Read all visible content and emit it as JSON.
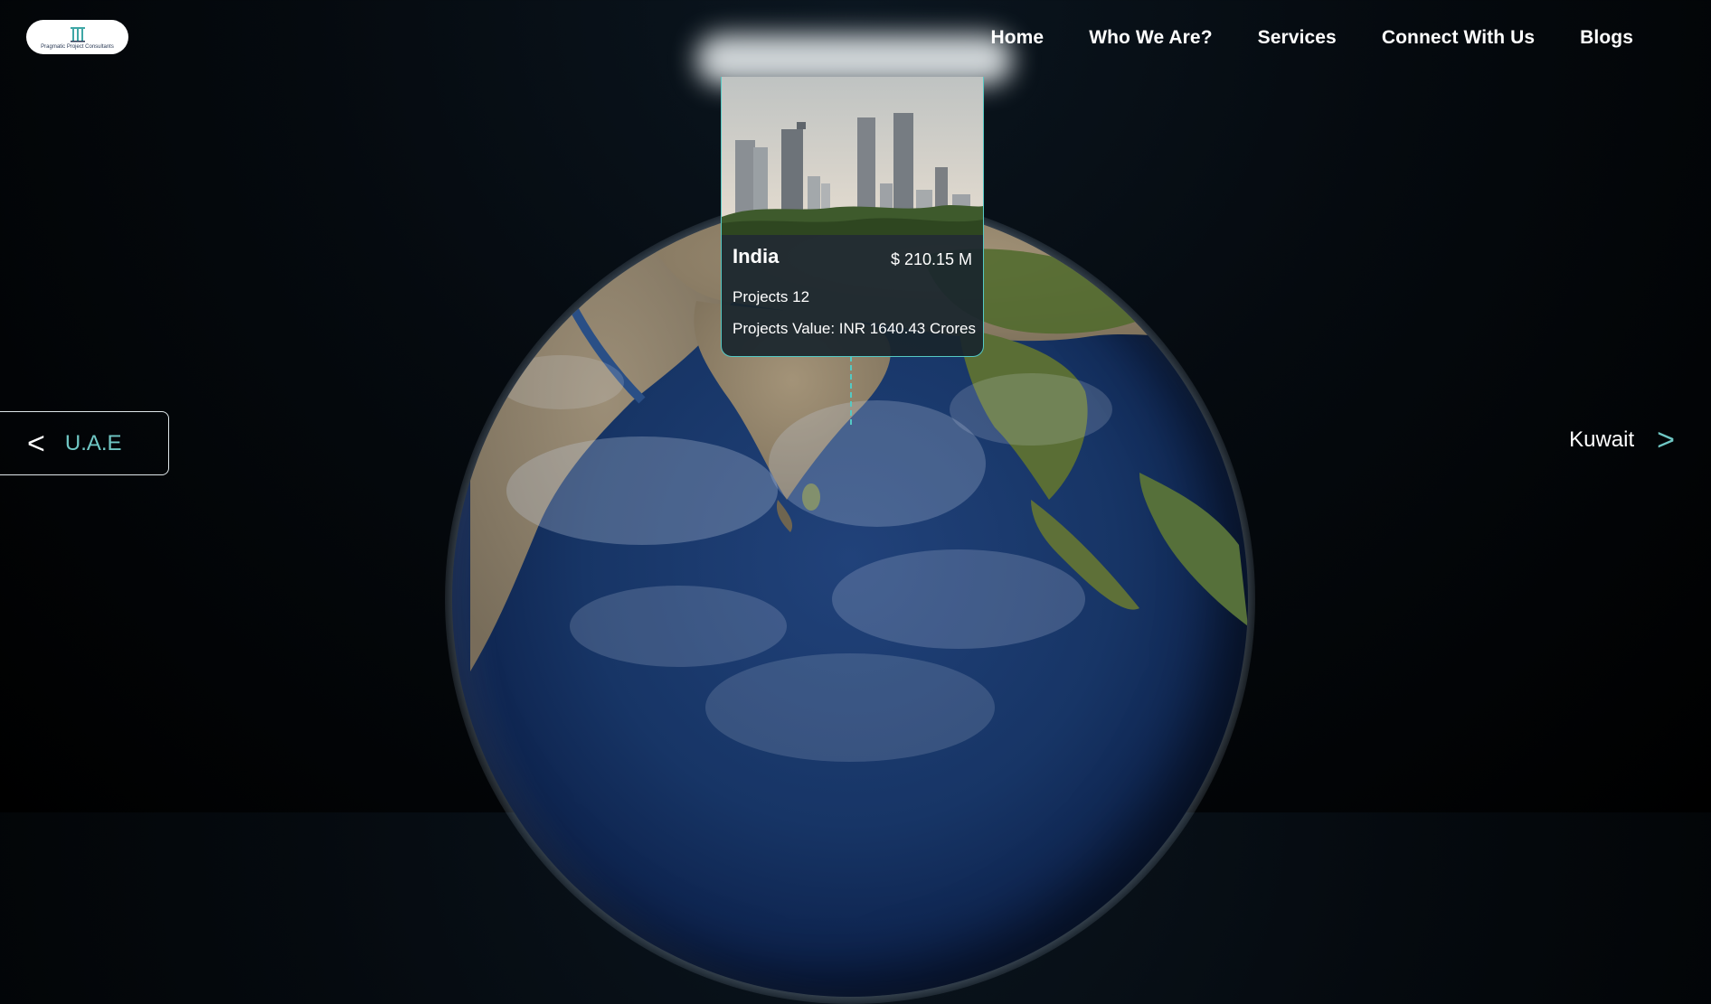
{
  "header": {
    "logo_text": "Pragmatic Project Consultants",
    "nav": [
      "Home",
      "Who We Are?",
      "Services",
      "Connect With Us",
      "Blogs"
    ]
  },
  "card": {
    "country": "India",
    "amount": "$ 210.15 M",
    "projects": "Projects 12",
    "value": "Projects Value: INR 1640.43 Crores",
    "photo_icon": "city-skyline-image"
  },
  "carousel": {
    "prev_arrow": "<",
    "prev_label": "U.A.E",
    "next_label": "Kuwait",
    "next_arrow": ">"
  },
  "colors": {
    "accent": "#55c9c4",
    "background": "#050a0f",
    "ocean": "#173566",
    "land": "#8a7c5e",
    "vegetation": "#4f6a2c"
  }
}
